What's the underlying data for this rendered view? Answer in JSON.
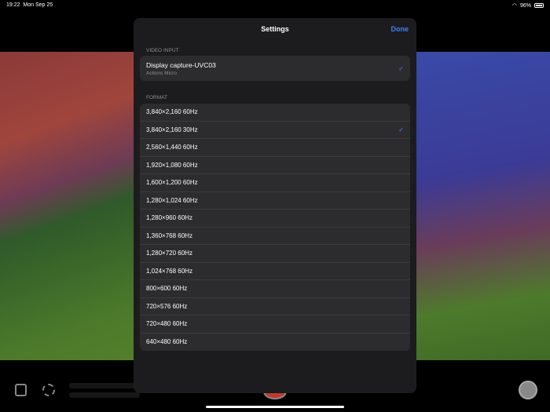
{
  "status": {
    "time": "19:22",
    "date": "Mon Sep 25",
    "battery": "96%"
  },
  "modal": {
    "title": "Settings",
    "done_label": "Done",
    "video_input": {
      "header": "VIDEO INPUT",
      "device": "Display capture-UVC03",
      "vendor": "Actions Micro",
      "selected": true
    },
    "format": {
      "header": "FORMAT",
      "selected_index": 1,
      "options": [
        "3,840×2,160 60Hz",
        "3,840×2,160 30Hz",
        "2,560×1,440 60Hz",
        "1,920×1,080 60Hz",
        "1,600×1,200 60Hz",
        "1,280×1,024 60Hz",
        "1,280×960 60Hz",
        "1,360×768 60Hz",
        "1,280×720 60Hz",
        "1,024×768 60Hz",
        "800×600 60Hz",
        "720×576 60Hz",
        "720×480 60Hz",
        "640×480 60Hz"
      ]
    }
  },
  "colors": {
    "accent": "#3a82f7",
    "record": "#c0392b"
  }
}
